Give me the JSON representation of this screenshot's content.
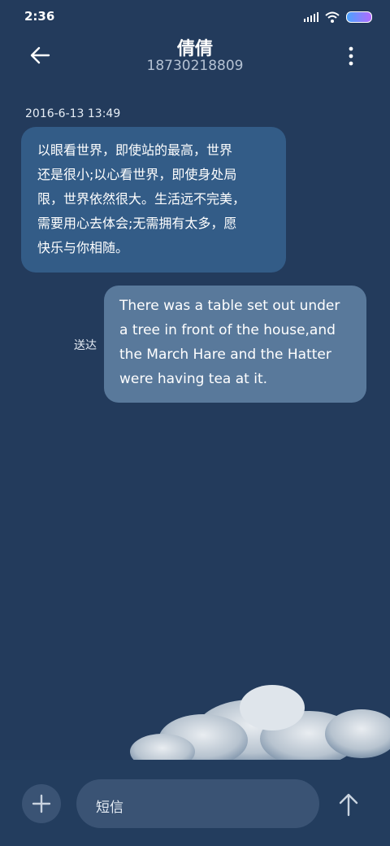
{
  "status_bar": {
    "time": "2:36"
  },
  "header": {
    "contact_name": "倩倩",
    "phone_number": "18730218809"
  },
  "messages": [
    {
      "direction": "incoming",
      "timestamp": "2016-6-13 13:49",
      "lines": [
        "以眼看世界，即使站的最高，世界",
        "还是很小;以心看世界，即使身处局",
        "限，世界依然很大。生活远不完美，",
        "需要用心去体会;无需拥有太多，愿",
        "快乐与你相随。"
      ]
    },
    {
      "direction": "outgoing",
      "status": "送达",
      "lines": [
        "There was a table set out under",
        "a tree in front of the house,and",
        "the March Hare and the Hatter",
        "were having tea at it."
      ]
    }
  ],
  "composer": {
    "placeholder": "短信"
  },
  "icons": {
    "back": "back-arrow-icon",
    "more": "more-vertical-icon",
    "add": "plus-icon",
    "send": "arrow-up-icon",
    "signal": "signal-icon",
    "wifi": "wifi-icon",
    "battery": "battery-icon"
  },
  "colors": {
    "background": "#233b5c",
    "incoming_bubble": "#335c87",
    "outgoing_bubble": "#59799b"
  }
}
